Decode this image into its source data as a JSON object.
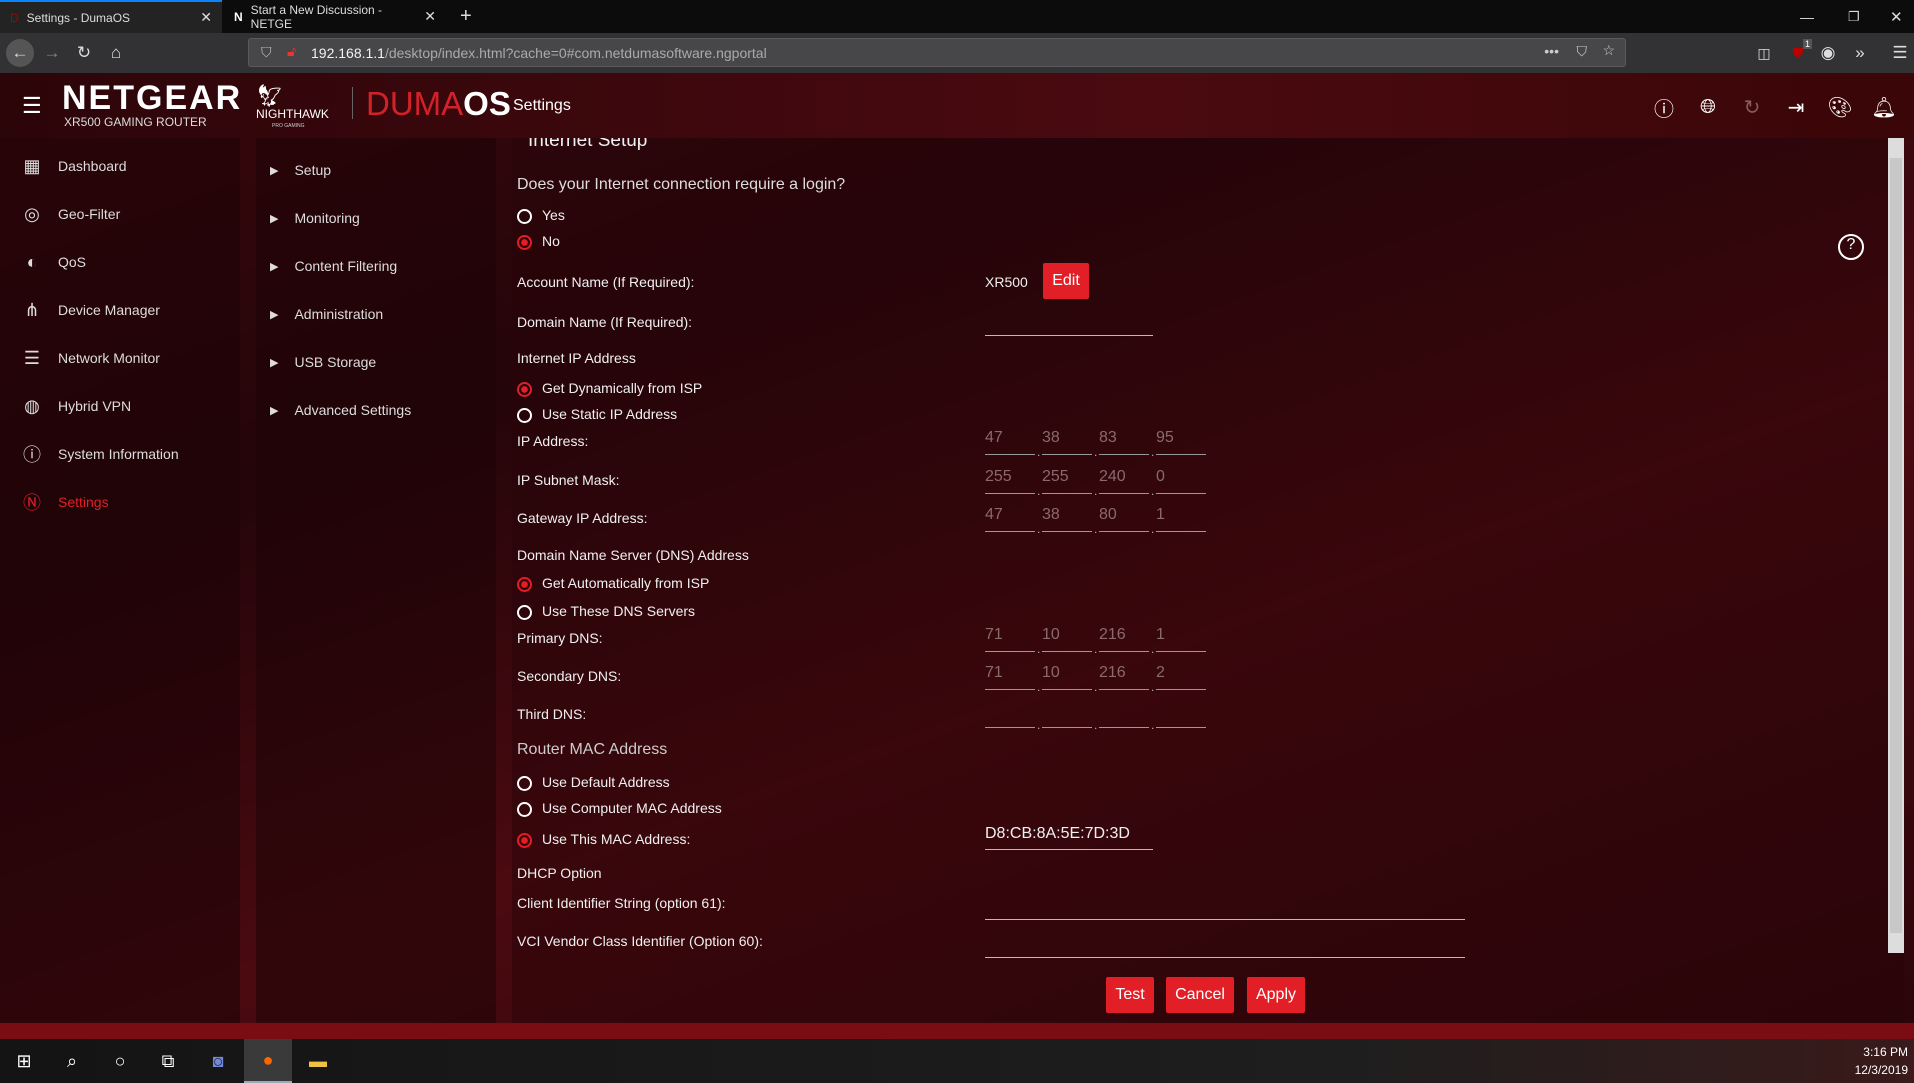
{
  "browser": {
    "tabs": [
      {
        "title": "Settings - DumaOS",
        "favicon": "D"
      },
      {
        "title": "Start a New Discussion - NETGE",
        "favicon": "N"
      }
    ],
    "url_host": "192.168.1.1",
    "url_path": "/desktop/index.html?cache=0#com.netdumasoftware.ngportal",
    "ublock_badge": "1"
  },
  "header": {
    "brand": "NETGEAR",
    "model": "XR500 GAMING ROUTER",
    "nighthawk": "NIGHTHAWK",
    "pro_gaming": "PRO GAMING",
    "duma": "DUMA",
    "os": "OS",
    "page": "Settings"
  },
  "sidebar": {
    "items": [
      {
        "label": "Dashboard",
        "icon": "dashboard-icon"
      },
      {
        "label": "Geo-Filter",
        "icon": "geo-filter-icon"
      },
      {
        "label": "QoS",
        "icon": "qos-icon"
      },
      {
        "label": "Device Manager",
        "icon": "device-manager-icon"
      },
      {
        "label": "Network Monitor",
        "icon": "network-monitor-icon"
      },
      {
        "label": "Hybrid VPN",
        "icon": "hybrid-vpn-icon"
      },
      {
        "label": "System Information",
        "icon": "system-information-icon"
      },
      {
        "label": "Settings",
        "icon": "settings-icon"
      }
    ]
  },
  "submenu": {
    "items": [
      "Setup",
      "Monitoring",
      "Content Filtering",
      "Administration",
      "USB Storage",
      "Advanced Settings"
    ]
  },
  "form": {
    "title": "Internet Setup",
    "login_question": "Does your Internet connection require a login?",
    "yes": "Yes",
    "no": "No",
    "account_label": "Account Name  (If Required):",
    "account_value": "XR500",
    "edit": "Edit",
    "domain_label": "Domain Name  (If Required):",
    "domain_value": "",
    "internet_ip_heading": "Internet IP Address",
    "dynamic": "Get Dynamically from ISP",
    "static": "Use Static IP Address",
    "ip_label": "IP Address:",
    "ip": [
      "47",
      "38",
      "83",
      "95"
    ],
    "mask_label": "IP Subnet Mask:",
    "mask": [
      "255",
      "255",
      "240",
      "0"
    ],
    "gateway_label": "Gateway IP Address:",
    "gateway": [
      "47",
      "38",
      "80",
      "1"
    ],
    "dns_heading": "Domain Name Server (DNS) Address",
    "dns_auto": "Get Automatically from ISP",
    "dns_manual": "Use These DNS Servers",
    "primary_label": "Primary DNS:",
    "primary": [
      "71",
      "10",
      "216",
      "1"
    ],
    "secondary_label": "Secondary DNS:",
    "secondary": [
      "71",
      "10",
      "216",
      "2"
    ],
    "third_label": "Third DNS:",
    "third": [
      "",
      "",
      "",
      ""
    ],
    "mac_heading": "Router MAC Address",
    "mac_default": "Use Default Address",
    "mac_computer": "Use Computer MAC Address",
    "mac_this": "Use This MAC Address:",
    "mac_value": "D8:CB:8A:5E:7D:3D",
    "dhcp_heading": "DHCP Option",
    "client_label": "Client Identifier String (option 61):",
    "client_value": "",
    "vci_label": "VCI Vendor Class Identifier (Option 60):",
    "vci_value": "",
    "test": "Test",
    "cancel": "Cancel",
    "apply": "Apply"
  },
  "taskbar": {
    "time": "3:16 PM",
    "date": "12/3/2019"
  }
}
